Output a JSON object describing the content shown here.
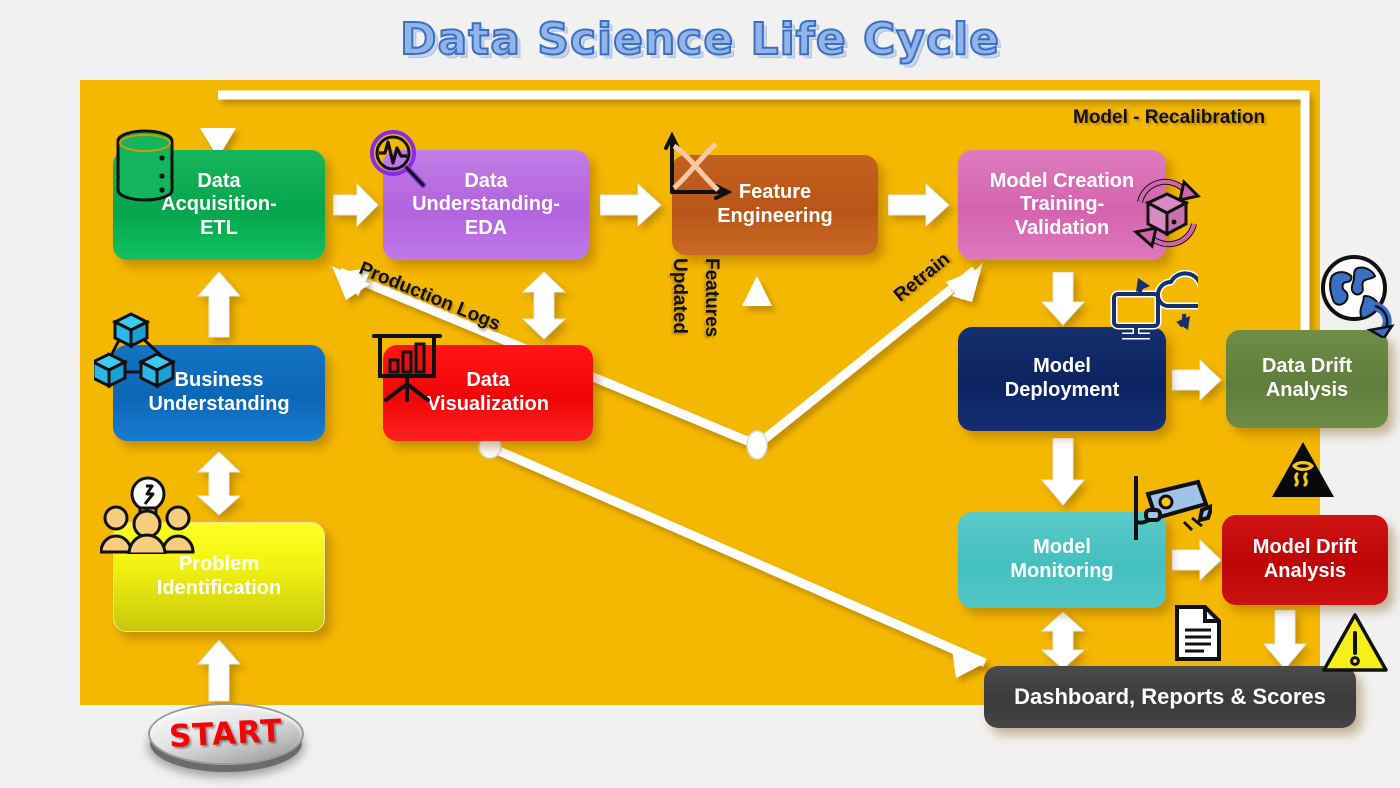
{
  "title": "Data Science Life Cycle",
  "canvas": {
    "background_color": "#f5b800",
    "page_background": "#f1f1f1"
  },
  "nodes": [
    {
      "id": "data-acquisition-etl",
      "label": "Data\nAcquisition-\nETL",
      "color": "#09a94e",
      "icon": "database-icon"
    },
    {
      "id": "data-understanding-eda",
      "label": "Data\nUnderstanding-\nEDA",
      "color": "#b263dd",
      "icon": "magnifier-pulse-icon"
    },
    {
      "id": "feature-engineering",
      "label": "Feature\nEngineering",
      "color": "#bb5a1a",
      "icon": "axis-curve-icon"
    },
    {
      "id": "model-creation",
      "label": "Model Creation\nTraining-\nValidation",
      "color": "#d666b0",
      "icon": "box-cycle-icon"
    },
    {
      "id": "business-understanding",
      "label": "Business\nUnderstanding",
      "color": "#0b6ab8",
      "icon": "network-cubes-icon"
    },
    {
      "id": "data-visualization",
      "label": "Data\nVisualization",
      "color": "#f00606",
      "icon": "presentation-chart-icon"
    },
    {
      "id": "problem-identification",
      "label": "Problem\nIdentification",
      "color": "#efef12",
      "icon": "team-bulb-icon"
    },
    {
      "id": "model-deployment",
      "label": "Model\nDeployment",
      "color": "#0c2360",
      "icon": "cloud-monitor-icon"
    },
    {
      "id": "data-drift-analysis",
      "label": "Data Drift\nAnalysis",
      "color": "#62813e",
      "icon": "globe-arrow-icon"
    },
    {
      "id": "model-monitoring",
      "label": "Model\nMonitoring",
      "color": "#47c0c0",
      "icon": "cctv-camera-icon"
    },
    {
      "id": "model-drift-analysis",
      "label": "Model Drift\nAnalysis",
      "color": "#be0707",
      "icon": "warning-triangle-yellow-icon"
    },
    {
      "id": "dashboard-reports-scores",
      "label": "Dashboard, Reports & Scores",
      "color": "#3d3d3d",
      "icon": "document-icon"
    }
  ],
  "line_labels": [
    {
      "id": "model-recalibration",
      "text": "Model - Recalibration"
    },
    {
      "id": "production-logs",
      "text": "Production Logs"
    },
    {
      "id": "updated",
      "text": "Updated"
    },
    {
      "id": "features",
      "text": "Features"
    },
    {
      "id": "retrain",
      "text": "Retrain"
    }
  ],
  "start_button": {
    "label": "START",
    "text_color": "#f20505"
  },
  "icons": [
    "database-icon",
    "magnifier-pulse-icon",
    "axis-curve-icon",
    "box-cycle-icon",
    "network-cubes-icon",
    "presentation-chart-icon",
    "team-bulb-icon",
    "cloud-monitor-icon",
    "globe-arrow-icon",
    "cctv-camera-icon",
    "document-icon",
    "skid-warning-icon",
    "warning-triangle-yellow-icon"
  ]
}
